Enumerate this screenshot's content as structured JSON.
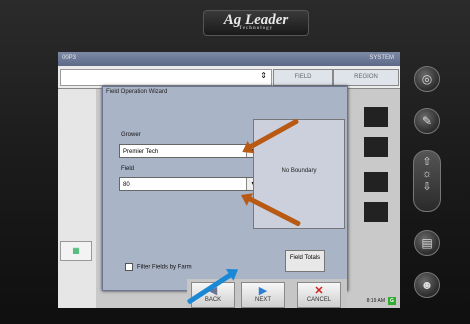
{
  "device": {
    "brand": "Ag Leader",
    "brand_sub": "Technology"
  },
  "screen": {
    "topbar": {
      "left_label": "00P3",
      "right_label": "SYSTEM"
    },
    "tabs": [
      {
        "label": "FIELD"
      },
      {
        "label": "REGION"
      }
    ],
    "address_glyph": "⇕"
  },
  "dialog": {
    "title": "Field Operation Wizard",
    "grower_label": "Grower",
    "grower_value": "Premier Tech",
    "field_label": "Field",
    "field_value": "80",
    "preview_text": "No Boundary",
    "filter_label": "Filter Fields by Farm",
    "field_totals_label": "Field Totals",
    "buttons": {
      "back": "BACK",
      "next": "NEXT",
      "cancel": "CANCEL"
    }
  },
  "status": {
    "time": "8:19 AM",
    "indicator": "G"
  },
  "colors": {
    "accent_arrow": "#b85a14",
    "next_arrow": "#1b88d6",
    "cancel_x": "#cc2222"
  },
  "side_buttons": [
    "map-icon",
    "wrench-icon",
    "brightness-updown-icon",
    "book-icon",
    "run-icon"
  ]
}
